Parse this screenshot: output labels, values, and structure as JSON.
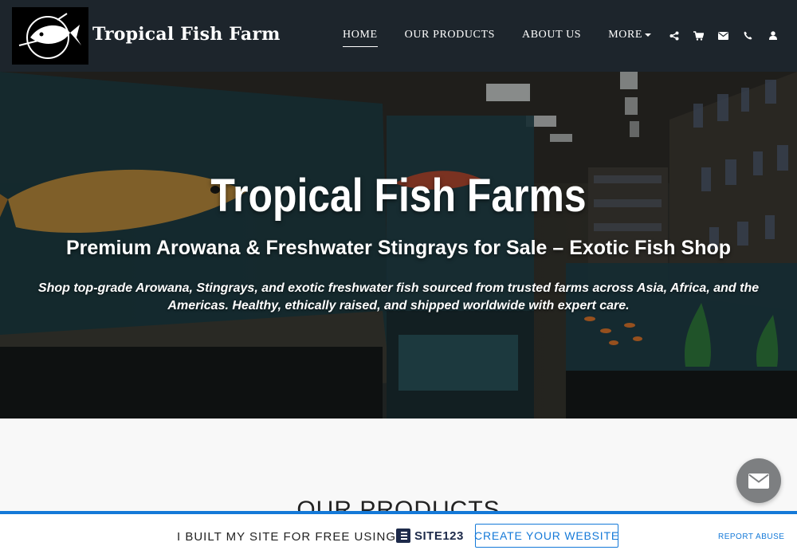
{
  "header": {
    "brand": "Tropical Fish Farm",
    "nav": {
      "home": "HOME",
      "products": "OUR PRODUCTS",
      "about": "ABOUT US",
      "more": "MORE"
    },
    "icons": [
      "share-icon",
      "cart-icon",
      "envelope-icon",
      "phone-icon",
      "user-icon"
    ]
  },
  "hero": {
    "title": "Tropical Fish Farms",
    "subtitle": "Premium Arowana & Freshwater Stingrays for Sale – Exotic Fish Shop",
    "description": "Shop top-grade Arowana, Stingrays, and exotic freshwater fish sourced from trusted farms across Asia, Africa, and the Americas. Healthy, ethically raised, and shipped worldwide with expert care."
  },
  "products": {
    "title": "OUR PRODUCTS"
  },
  "banner": {
    "text": "I BUILT MY SITE FOR FREE USING",
    "logo_text": "SITE123",
    "create_button": "CREATE YOUR WEBSITE",
    "report": "REPORT ABUSE",
    "accent": "#1479d8"
  },
  "colors": {
    "header_bg": "#1d252c",
    "chat_button": "#7d7f81"
  }
}
